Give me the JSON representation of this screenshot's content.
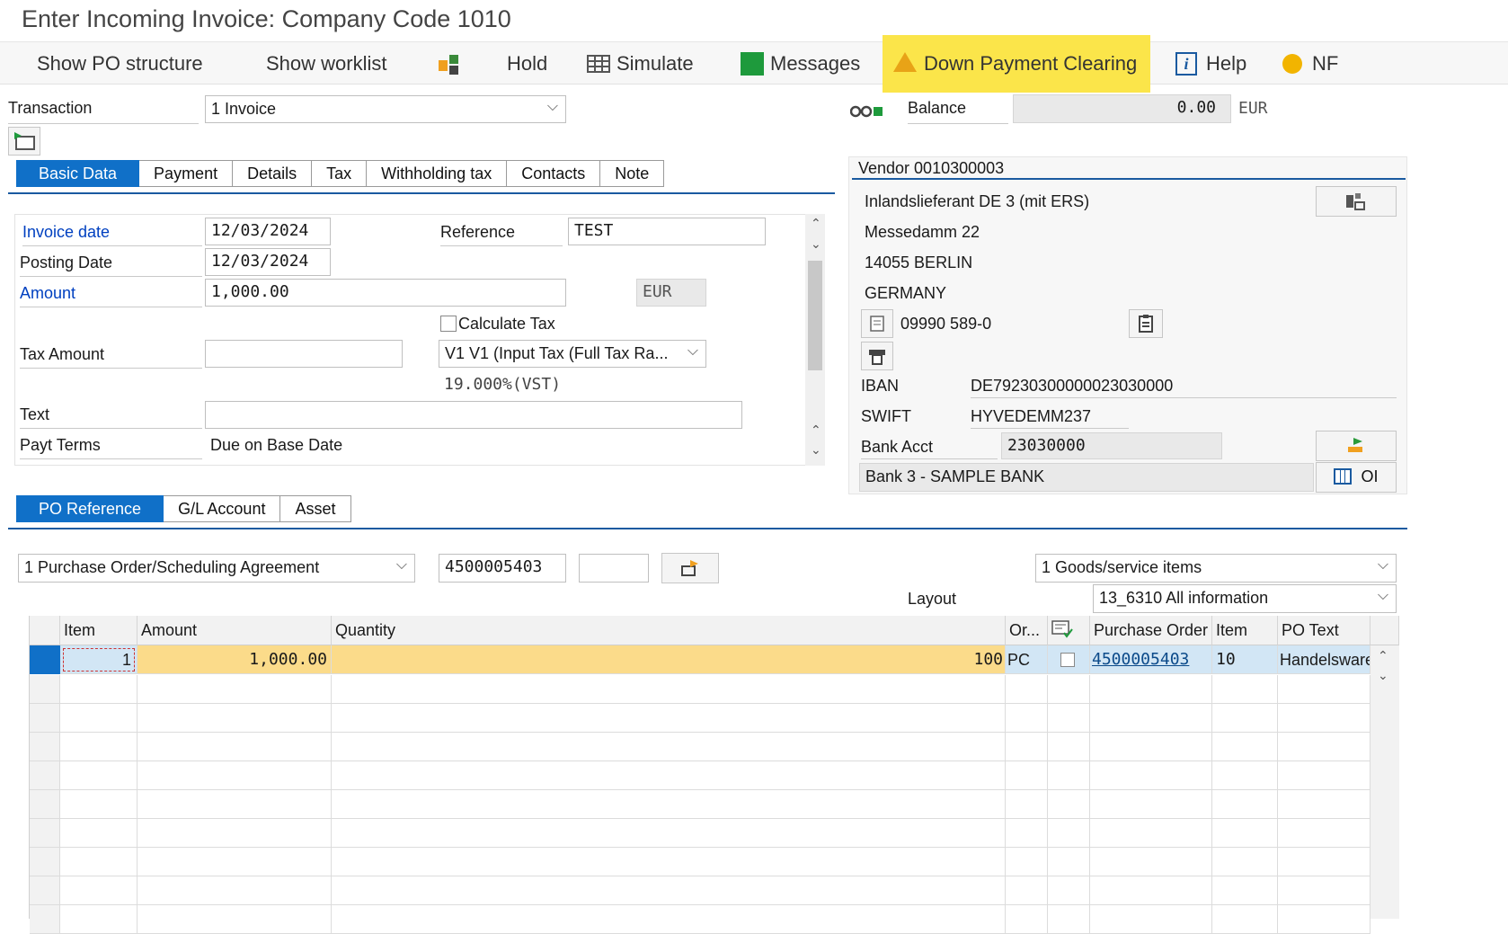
{
  "window": {
    "title": "Enter Incoming Invoice: Company Code 1010"
  },
  "toolbar": {
    "show_po_structure": "Show PO structure",
    "show_worklist": "Show worklist",
    "hold": "Hold",
    "simulate": "Simulate",
    "messages": "Messages",
    "down_payment_clearing": "Down Payment Clearing",
    "help": "Help",
    "nf": "NF"
  },
  "header": {
    "transaction_label": "Transaction",
    "transaction_value": "1 Invoice",
    "balance_label": "Balance",
    "balance_value": "0.00",
    "balance_currency": "EUR"
  },
  "tabs_top": [
    "Basic Data",
    "Payment",
    "Details",
    "Tax",
    "Withholding tax",
    "Contacts",
    "Note"
  ],
  "basic_data": {
    "invoice_date_label": "Invoice date",
    "invoice_date": "12/03/2024",
    "posting_date_label": "Posting Date",
    "posting_date": "12/03/2024",
    "reference_label": "Reference",
    "reference": "TEST",
    "amount_label": "Amount",
    "amount": "1,000.00",
    "currency": "EUR",
    "calculate_tax_label": "Calculate Tax",
    "tax_amount_label": "Tax Amount",
    "tax_amount": "",
    "tax_code": "V1 V1 (Input Tax (Full Tax Ra...",
    "tax_rate": "19.000%(VST)",
    "text_label": "Text",
    "text": "",
    "payt_terms_label": "Payt Terms",
    "payt_terms": "Due on Base Date"
  },
  "vendor": {
    "title": "Vendor 0010300003",
    "name": "Inlandslieferant DE 3 (mit ERS)",
    "street": "Messedamm 22",
    "city": "14055 BERLIN",
    "country": "GERMANY",
    "phone": "09990 589-0",
    "iban_label": "IBAN",
    "iban": "DE79230300000023030000",
    "swift_label": "SWIFT",
    "swift": "HYVEDEMM237",
    "bank_acct_label": "Bank Acct",
    "bank_acct": "23030000",
    "bank_name": "Bank 3 - SAMPLE BANK",
    "oi_label": "OI"
  },
  "tabs_bottom": [
    "PO Reference",
    "G/L Account",
    "Asset"
  ],
  "po_reference": {
    "doc_type": "1 Purchase Order/Scheduling Agreement",
    "po_number": "4500005403",
    "po_item": "",
    "items_select": "1 Goods/service items",
    "layout_label": "Layout",
    "layout": "13_6310 All information"
  },
  "grid": {
    "columns": [
      "Item",
      "Amount",
      "Quantity",
      "Or...",
      "",
      "Purchase Order",
      "Item",
      "PO Text"
    ],
    "rows": [
      {
        "item": "1",
        "amount": "1,000.00",
        "quantity": "100",
        "order_unit": "PC",
        "purchase_order": "4500005403",
        "po_item": "10",
        "po_text": "Handelsware"
      }
    ]
  },
  "colors": {
    "accent": "#1070c8",
    "highlight": "#fbe54a",
    "selected_row": "#fbdb8a",
    "row_blue": "#d2e6f5"
  }
}
